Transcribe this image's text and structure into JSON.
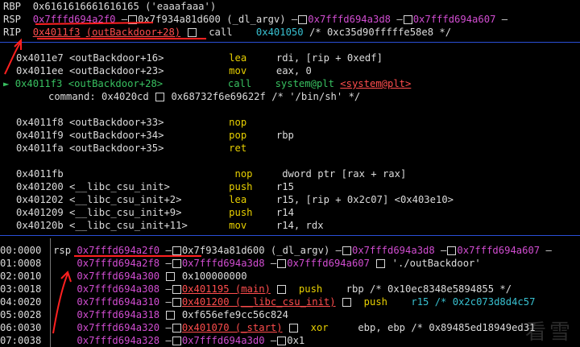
{
  "registers": {
    "rbp": {
      "name": "RBP",
      "value": "0x6161616661616165",
      "string": "('eaaafaaa')"
    },
    "rsp": {
      "name": "RSP",
      "value": "0x7fffd694a2f0",
      "link1": "0x7f934a81d600",
      "link1_sym": "(_dl_argv)",
      "link2": "0x7fffd694a3d8",
      "link3": "0x7fffd694a607"
    },
    "rip": {
      "name": "RIP",
      "value": "0x4011f3",
      "sym": "(outBackdoor+28)",
      "instr": "call",
      "target": "0x401050",
      "comment": "/* 0xc35d90fffffe58e8 */"
    }
  },
  "disasm": [
    {
      "addr": "0x4011e7",
      "sym": "<outBackdoor+16>",
      "mnem": "lea",
      "ops": "rdi, [rip + 0xedf]"
    },
    {
      "addr": "0x4011ee",
      "sym": "<outBackdoor+23>",
      "mnem": "mov",
      "ops": "eax, 0"
    },
    {
      "marker": "►",
      "addr": "0x4011f3",
      "sym": "<outBackdoor+28>",
      "mnem": "call",
      "ops": "system@plt",
      "call_target": "<system@plt>",
      "current": true
    },
    {
      "command_label": "command: 0x4020cd",
      "command_ptr": "0x68732f6e69622f",
      "command_comment": "/* '/bin/sh' */"
    },
    {
      "addr": "0x4011f8",
      "sym": "<outBackdoor+33>",
      "mnem": "nop",
      "ops": ""
    },
    {
      "addr": "0x4011f9",
      "sym": "<outBackdoor+34>",
      "mnem": "pop",
      "ops": "rbp"
    },
    {
      "addr": "0x4011fa",
      "sym": "<outBackdoor+35>",
      "mnem": "ret",
      "ops": ""
    },
    {
      "addr": "0x4011fb",
      "sym": "",
      "mnem": "nop",
      "ops": "dword ptr [rax + rax]"
    },
    {
      "addr": "0x401200",
      "sym": "<__libc_csu_init>",
      "mnem": "push",
      "ops": "r15"
    },
    {
      "addr": "0x401202",
      "sym": "<__libc_csu_init+2>",
      "mnem": "lea",
      "ops": "r15, [rip + 0x2c07] <0x403e10>"
    },
    {
      "addr": "0x401209",
      "sym": "<__libc_csu_init+9>",
      "mnem": "push",
      "ops": "r14"
    },
    {
      "addr": "0x40120b",
      "sym": "<__libc_csu_init+11>",
      "mnem": "mov",
      "ops": "r14, rdx"
    }
  ],
  "stack": [
    {
      "idx": "00:0000",
      "reg": "rsp",
      "addr": "0x7fffd694a2f0",
      "rest": [
        "0x7f934a81d600",
        "(_dl_argv)",
        "0x7fffd694a3d8",
        "0x7fffd694a607"
      ]
    },
    {
      "idx": "01:0008",
      "reg": "",
      "addr": "0x7fffd694a2f8",
      "rest": [
        "0x7fffd694a3d8",
        "0x7fffd694a607",
        "'./outBackdoor'"
      ]
    },
    {
      "idx": "02:0010",
      "reg": "",
      "addr": "0x7fffd694a300",
      "rest": [
        "0x100000000"
      ]
    },
    {
      "idx": "03:0018",
      "reg": "",
      "addr": "0x7fffd694a308",
      "rest": [
        "0x401195 (main)",
        "push",
        "rbp /* 0x10ec8348e5894855 */"
      ]
    },
    {
      "idx": "04:0020",
      "reg": "",
      "addr": "0x7fffd694a310",
      "rest": [
        "0x401200 (__libc_csu_init)",
        "push",
        "r15 /* 0x2c073d8d4c57"
      ]
    },
    {
      "idx": "05:0028",
      "reg": "",
      "addr": "0x7fffd694a318",
      "rest": [
        "0xf656efe9cc56c824"
      ]
    },
    {
      "idx": "06:0030",
      "reg": "",
      "addr": "0x7fffd694a320",
      "rest": [
        "0x401070 (_start)",
        "xor",
        "ebp, ebp /* 0x89485ed18949ed31"
      ]
    },
    {
      "idx": "07:0038",
      "reg": "",
      "addr": "0x7fffd694a328",
      "rest": [
        "0x7fffd694a3d0",
        "0x1"
      ]
    }
  ],
  "watermark": "看雪",
  "colors": {
    "yellow": "#e8d000",
    "red": "#ff4d4d",
    "magenta": "#d14dd1",
    "cyan": "#38c0d0",
    "green": "#38c060",
    "separator": "#2a4fd6"
  }
}
